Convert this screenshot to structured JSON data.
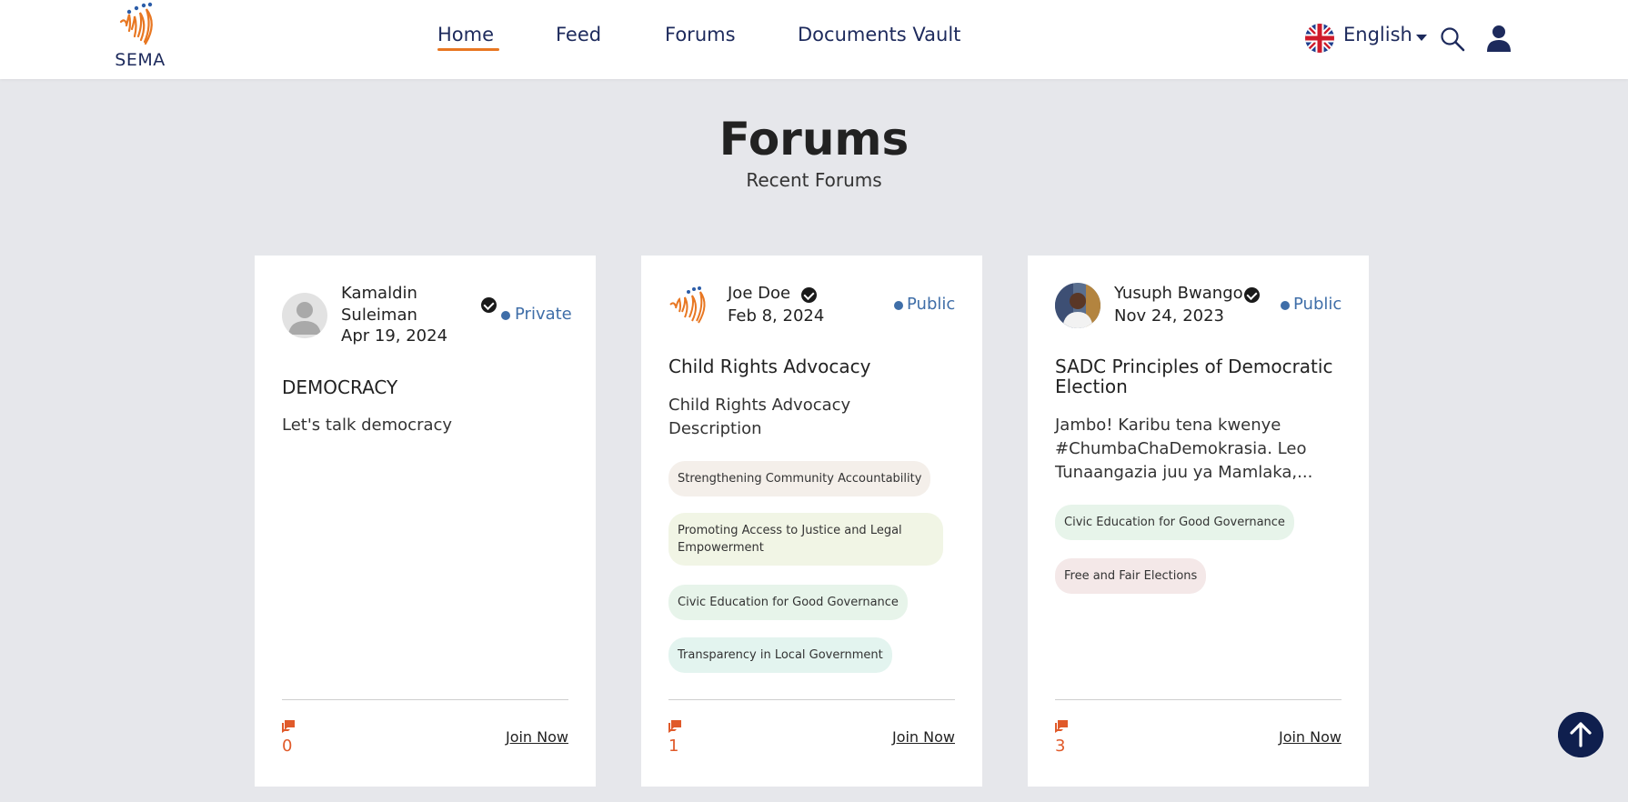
{
  "header": {
    "logo_text": "SEMA",
    "nav": [
      "Home",
      "Feed",
      "Forums",
      "Documents Vault"
    ],
    "language": "English"
  },
  "page": {
    "title": "Forums",
    "subtitle": "Recent Forums"
  },
  "cards": [
    {
      "author": "Kamaldin Suleiman",
      "date": "Apr 19, 2024",
      "visibility": "Private",
      "title": "DEMOCRACY",
      "description": "Let's talk democracy",
      "tags": [],
      "comments": "0",
      "join": "Join Now"
    },
    {
      "author": "Joe Doe",
      "date": "Feb 8, 2024",
      "visibility": "Public",
      "title": "Child Rights Advocacy",
      "description": "Child Rights Advocacy Description",
      "tags": [
        "Strengthening Community Accountability",
        "Promoting Access to Justice and Legal Empowerment",
        "Civic Education for Good Governance",
        "Transparency in Local Government"
      ],
      "comments": "1",
      "join": "Join Now"
    },
    {
      "author": "Yusuph Bwango",
      "date": "Nov 24, 2023",
      "visibility": "Public",
      "title": "SADC Principles of Democratic Election",
      "description": "Jambo! Karibu tena kwenye #ChumbaChaDemokrasia. Leo Tunaangazia juu ya Mamlaka,...",
      "tags": [
        "Civic Education for Good Governance",
        "Free and Fair Elections"
      ],
      "comments": "3",
      "join": "Join Now"
    }
  ],
  "colors": {
    "accent": "#e87722",
    "navy": "#1d2a5c",
    "visibility": "#3f6ea8",
    "comment": "#e05a2a",
    "background": "#e6e7eb"
  },
  "icons": [
    "sema-logo",
    "uk-flag-icon",
    "caret-down-icon",
    "search-icon",
    "user-icon",
    "verified-icon",
    "comment-icon",
    "arrow-up-icon"
  ]
}
